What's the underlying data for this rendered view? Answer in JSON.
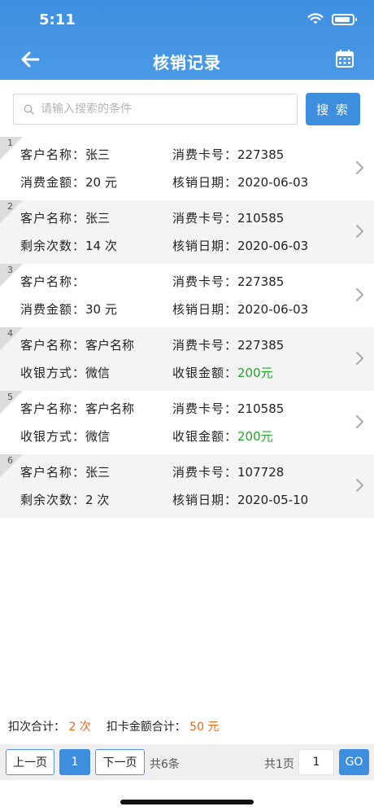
{
  "status_bar": {
    "time": "5:11"
  },
  "header": {
    "title": "核销记录"
  },
  "search": {
    "placeholder": "请输入搜索的条件",
    "value": "",
    "button_label": "搜 索"
  },
  "records": [
    {
      "index": "1",
      "name_label": "客户名称：",
      "name": "张三",
      "card_label": "消费卡号：",
      "card": "227385",
      "f3_label": "消费金额：",
      "f3": "20 元",
      "f4_label": "核销日期：",
      "f4": "2020-06-03"
    },
    {
      "index": "2",
      "name_label": "客户名称：",
      "name": "张三",
      "card_label": "消费卡号：",
      "card": "210585",
      "f3_label": "剩余次数：",
      "f3": "14 次",
      "f4_label": "核销日期：",
      "f4": "2020-06-03"
    },
    {
      "index": "3",
      "name_label": "客户名称：",
      "name": "",
      "card_label": "消费卡号：",
      "card": "227385",
      "f3_label": "消费金额：",
      "f3": "30 元",
      "f4_label": "核销日期：",
      "f4": "2020-06-03"
    },
    {
      "index": "4",
      "name_label": "客户名称：",
      "name": "客户名称",
      "card_label": "消费卡号：",
      "card": "227385",
      "f3_label": "收银方式：",
      "f3": "微信",
      "f4_label": "收银金额：",
      "f4": "200元"
    },
    {
      "index": "5",
      "name_label": "客户名称：",
      "name": "客户名称",
      "card_label": "消费卡号：",
      "card": "210585",
      "f3_label": "收银方式：",
      "f3": "微信",
      "f4_label": "收银金额：",
      "f4": "200元"
    },
    {
      "index": "6",
      "name_label": "客户名称：",
      "name": "张三",
      "card_label": "消费卡号：",
      "card": "107728",
      "f3_label": "剩余次数：",
      "f3": "2 次",
      "f4_label": "核销日期：",
      "f4": "2020-05-10"
    }
  ],
  "summary": {
    "count_label": "扣次合计：",
    "count_value": "2 次",
    "amount_label": "扣卡金额合计：",
    "amount_value": "50 元"
  },
  "pager": {
    "prev_label": "上一页",
    "current_page": "1",
    "next_label": "下一页",
    "total_label": "共6条",
    "pages_label": "共1页",
    "input_value": "1",
    "go_label": "GO"
  },
  "colors": {
    "primary": "#3d8fde",
    "green": "#22a52a",
    "orange": "#f06414"
  }
}
